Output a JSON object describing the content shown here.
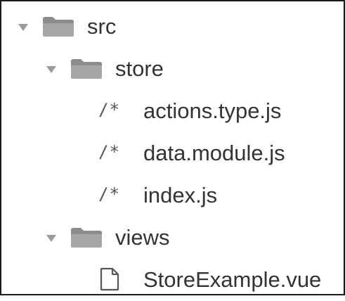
{
  "file_tree": {
    "items": [
      {
        "label": "src",
        "type": "folder",
        "expanded": true,
        "icon": "folder-icon"
      },
      {
        "label": "store",
        "type": "folder",
        "expanded": true,
        "icon": "folder-icon"
      },
      {
        "label": "actions.type.js",
        "type": "file",
        "icon": "js-file-icon",
        "icon_glyph": "/*"
      },
      {
        "label": "data.module.js",
        "type": "file",
        "icon": "js-file-icon",
        "icon_glyph": "/*"
      },
      {
        "label": "index.js",
        "type": "file",
        "icon": "js-file-icon",
        "icon_glyph": "/*"
      },
      {
        "label": "views",
        "type": "folder",
        "expanded": true,
        "icon": "folder-icon"
      },
      {
        "label": "StoreExample.vue",
        "type": "file",
        "icon": "file-icon"
      }
    ]
  },
  "colors": {
    "folder": "#8c8c8c",
    "text": "#333333",
    "twisty": "#9a9a9a",
    "border": "#1a1a1a"
  }
}
